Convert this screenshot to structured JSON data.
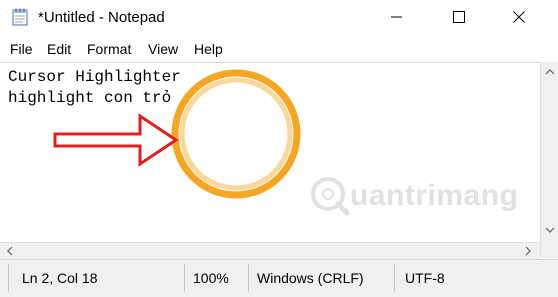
{
  "window": {
    "title": "*Untitled - Notepad",
    "icon": "notepad-icon",
    "controls": [
      "minimize-icon",
      "maximize-icon",
      "close-icon"
    ]
  },
  "menu": {
    "file": "File",
    "edit": "Edit",
    "format": "Format",
    "view": "View",
    "help": "Help"
  },
  "editor": {
    "lines": [
      "Cursor Highlighter",
      "highlight con trỏ"
    ]
  },
  "status": {
    "position": "Ln 2, Col 18",
    "zoom": "100%",
    "line_ending": "Windows (CRLF)",
    "encoding": "UTF-8"
  },
  "overlay": {
    "highlight_color": "#f5a623",
    "arrow_color": "#e02020"
  },
  "watermark": {
    "text": "uantrimang"
  }
}
